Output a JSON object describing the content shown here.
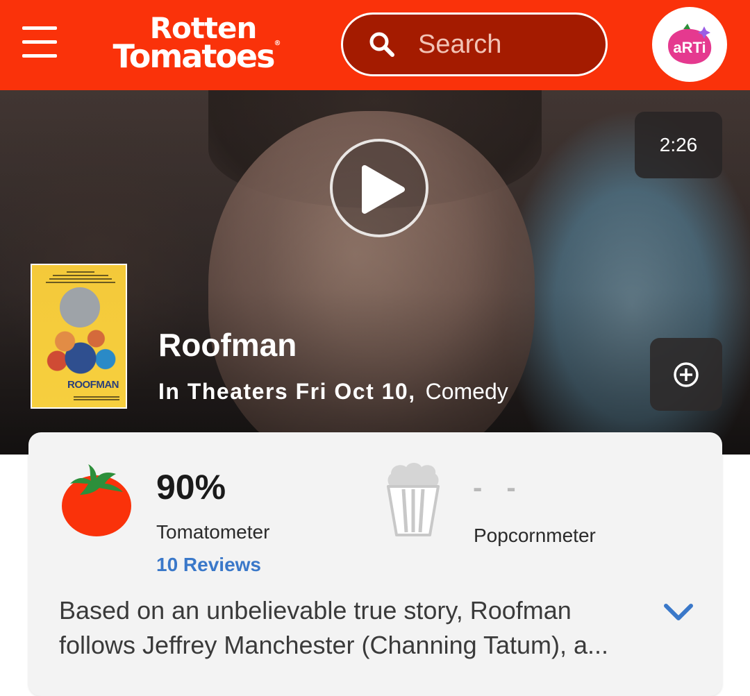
{
  "header": {
    "logo_line1": "Rotten",
    "logo_line2": "Tomatoes",
    "logo_mark": "®",
    "search_placeholder": "Search",
    "avatar_text": "aRTi",
    "brand_color": "#fa320a"
  },
  "hero": {
    "duration": "2:26",
    "poster_title": "ROOFMAN",
    "title": "Roofman",
    "release": "In Theaters Fri Oct 10,",
    "genre": "Comedy"
  },
  "scores": {
    "tomatometer_value": "90%",
    "tomatometer_label": "Tomatometer",
    "reviews_link": "10 Reviews",
    "popcornmeter_value": "- -",
    "popcornmeter_label": "Popcornmeter",
    "link_color": "#3a78c9"
  },
  "synopsis": {
    "line1": "Based on an unbelievable true story, Roofman",
    "line2": "follows Jeffrey Manchester (Channing Tatum), a..."
  }
}
